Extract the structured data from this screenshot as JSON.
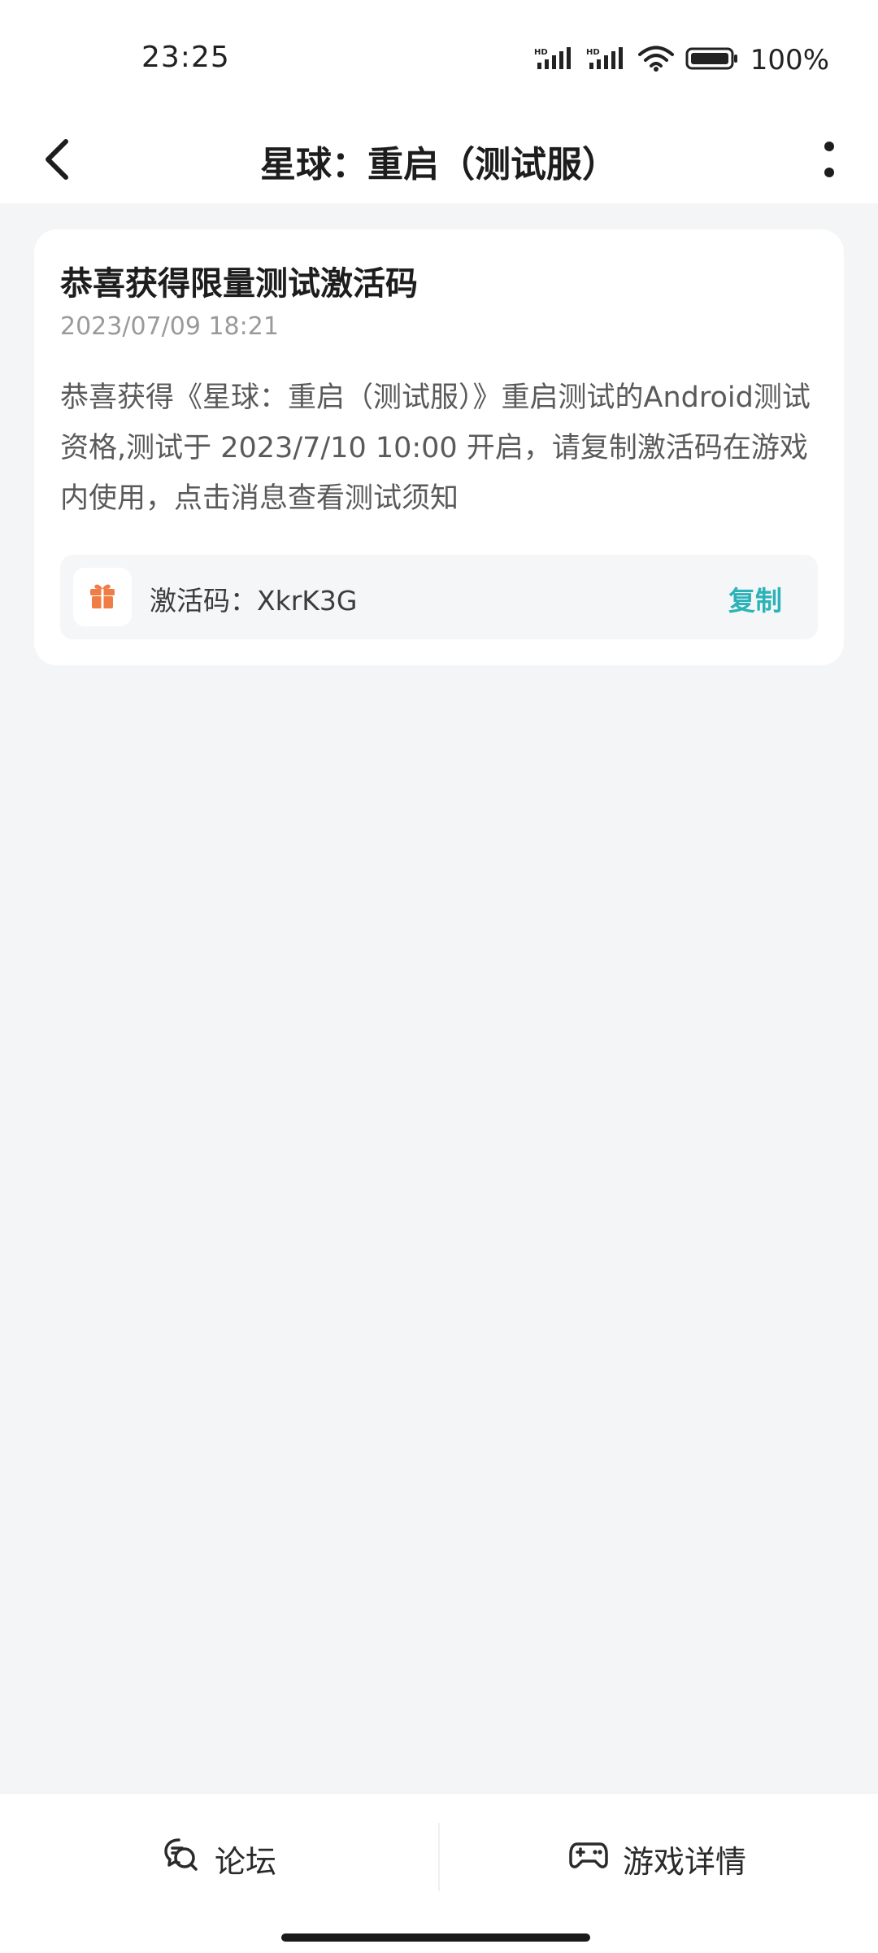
{
  "status_bar": {
    "time": "23:25",
    "battery": "100%",
    "icons": [
      "hd-signal-icon",
      "hd-signal-icon",
      "wifi-icon",
      "battery-icon"
    ]
  },
  "app_bar": {
    "title": "星球：重启（测试服）",
    "back_icon": "chevron-left-icon",
    "more_icon": "more-vertical-icon"
  },
  "message": {
    "title": "恭喜获得限量测试激活码",
    "timestamp": "2023/07/09 18:21",
    "body": "恭喜获得《星球：重启（测试服）》重启测试的Android测试资格,测试于 2023/7/10 10:00 开启，请复制激活码在游戏内使用，点击消息查看测试须知",
    "code_label": "激活码：XkrK3G",
    "copy_label": "复制",
    "gift_icon": "gift-icon"
  },
  "bottom_bar": {
    "forum_label": "论坛",
    "details_label": "游戏详情"
  },
  "colors": {
    "accent": "#2bb3b8",
    "gift": "#f07d45",
    "background": "#f4f5f7"
  }
}
